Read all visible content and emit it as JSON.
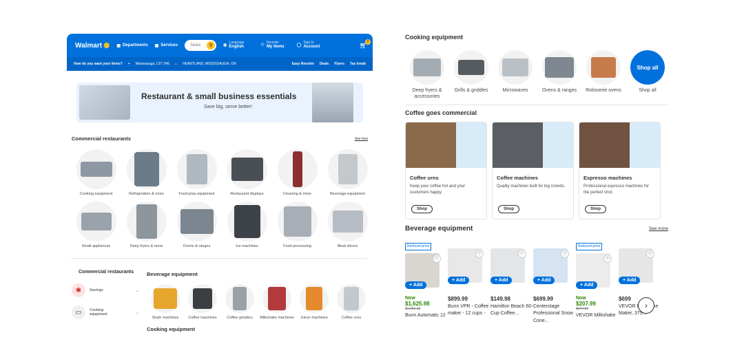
{
  "header": {
    "logo": "Walmart",
    "departments": "Departments",
    "services": "Services",
    "search_placeholder": "Searc",
    "language_small": "Language",
    "language": "English",
    "reorder_small": "Reorder",
    "my_items": "My Items",
    "signin_small": "Sign In",
    "account": "Account",
    "cart_count": "0",
    "delivery_prompt": "How do you want your items?",
    "location": "Mississauga, L5T 2H6",
    "store": "HEARTLAND, MISSISSAUGA, ON",
    "links": [
      "Easy Reorder",
      "Deals",
      "Flyers",
      "Tax break"
    ]
  },
  "banner": {
    "title": "Restaurant & small business essentials",
    "subtitle": "Save big, serve better!"
  },
  "commercial": {
    "title": "Commercial restaurants",
    "see_less": "See less",
    "categories": [
      "Cooking equipment",
      "Refrigeration & more",
      "Food prep equipment",
      "Restaurant displays",
      "Cleaning & more",
      "Beverage equipment",
      "Small appliances",
      "Deep fryers & more",
      "Ovens & ranges",
      "Ice machines",
      "Food processing",
      "Meat slicers"
    ]
  },
  "side_nav": {
    "title": "Commercial restaurants",
    "items": [
      "Savings",
      "Cooking equipment"
    ]
  },
  "beverage_sub": {
    "title": "Beverage equipment",
    "items": [
      "Slush machines",
      "Coffee machines",
      "Coffee grinders",
      "Milkshake machines",
      "Juicer machines",
      "Coffee urns"
    ],
    "next_title": "Cooking equipment"
  },
  "cooking": {
    "title": "Cooking equipment",
    "items": [
      "Deep fryers & accessories",
      "Grills & griddles",
      "Microwaves",
      "Ovens & ranges",
      "Rotisserie ovens",
      "Shop all"
    ],
    "shop_all_circle": "Shop all"
  },
  "coffee": {
    "title": "Coffee goes commercial",
    "cards": [
      {
        "name": "Coffee urns",
        "desc": "Keep your coffee hot and your customers happy.",
        "btn": "Shop"
      },
      {
        "name": "Coffee machines",
        "desc": "Quality machines built for big crowds.",
        "btn": "Shop"
      },
      {
        "name": "Espresso machines",
        "desc": "Professional espresso machines for the perfect shot.",
        "btn": "Shop"
      }
    ]
  },
  "bev_products": {
    "title": "Beverage equipment",
    "see_more": "See more",
    "badge": "Reduced price",
    "add": "+ Add",
    "now": "Now",
    "items": [
      {
        "reduced": true,
        "now": true,
        "price": "$1,625.98",
        "was": "$1,951.18",
        "name": "Bunn Automatic 12"
      },
      {
        "reduced": false,
        "now": false,
        "price": "$899.99",
        "was": "",
        "name": "Bunn VPR - Coffee maker - 12 cups -"
      },
      {
        "reduced": false,
        "now": false,
        "price": "$149.98",
        "was": "",
        "name": "Hamilton Beach 60-Cup Coffee..."
      },
      {
        "reduced": false,
        "now": false,
        "price": "$699.99",
        "was": "",
        "name": "Centerstage Professional Snow Cone..."
      },
      {
        "reduced": true,
        "now": true,
        "price": "$207.99",
        "was": "$247.00",
        "name": "VEVOR Milkshake"
      },
      {
        "reduced": false,
        "now": false,
        "price": "$699",
        "was": "",
        "name": "VEVOR Milkshake Maker, 375..."
      }
    ]
  },
  "colors": {
    "brand_blue": "#0071dc",
    "spark_yellow": "#ffc220",
    "price_green": "#2a8703"
  }
}
